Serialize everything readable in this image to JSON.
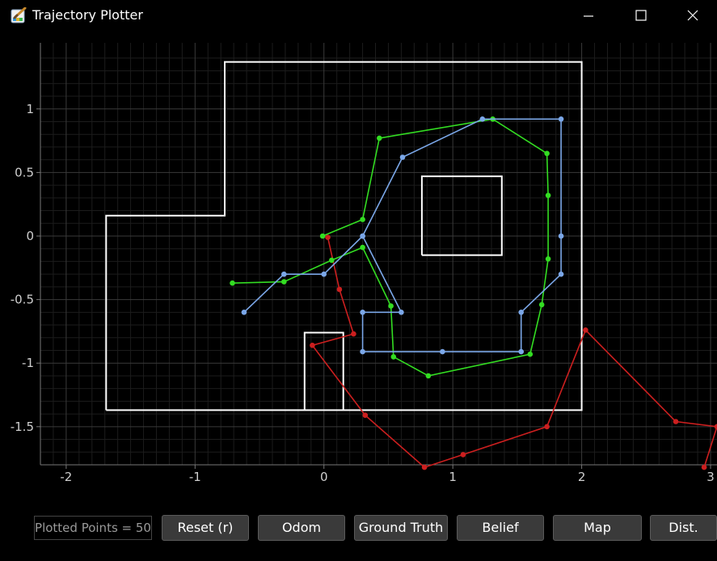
{
  "window": {
    "title": "Trajectory Plotter",
    "app_icon": "paint-brush-icon",
    "controls": [
      "minimize-icon",
      "maximize-icon",
      "close-icon"
    ]
  },
  "colors": {
    "background": "#000000",
    "grid_major": "#3a3a3a",
    "grid_minor": "#1c1c1c",
    "map": "#ffffff",
    "odom": "#cc1f1f",
    "ground_truth": "#33dd22",
    "belief": "#7ba7e8"
  },
  "bottom_bar": {
    "counter": "Plotted Points = 50",
    "buttons": {
      "reset": "Reset (r)",
      "odom": "Odom",
      "ground_truth": "Ground Truth",
      "belief": "Belief",
      "map": "Map",
      "dist": "Dist."
    }
  },
  "chart_data": {
    "type": "line",
    "xlim": [
      -2.2,
      3.05
    ],
    "ylim": [
      -1.8,
      1.52
    ],
    "xticks": [
      "-2",
      "-1",
      "0",
      "1",
      "2",
      "3"
    ],
    "yticks": [
      "1",
      "0.5",
      "0",
      "-0.5",
      "-1",
      "-1.5"
    ],
    "grid": true,
    "map_walls": [
      [
        [
          -1.69,
          -1.37
        ],
        [
          -1.69,
          0.16
        ],
        [
          -0.77,
          0.16
        ],
        [
          -0.77,
          1.37
        ],
        [
          2.0,
          1.37
        ],
        [
          2.0,
          -1.37
        ],
        [
          -1.69,
          -1.37
        ]
      ],
      [
        [
          0.76,
          -0.15
        ],
        [
          1.38,
          -0.15
        ],
        [
          1.38,
          0.47
        ],
        [
          0.76,
          0.47
        ],
        [
          0.76,
          -0.15
        ]
      ],
      [
        [
          -0.15,
          -1.37
        ],
        [
          -0.15,
          -0.76
        ],
        [
          0.15,
          -0.76
        ],
        [
          0.15,
          -1.37
        ]
      ]
    ],
    "series": [
      {
        "key": "odom",
        "points": [
          [
            0.03,
            -0.01
          ],
          [
            0.12,
            -0.42
          ],
          [
            0.23,
            -0.77
          ],
          [
            -0.09,
            -0.86
          ],
          [
            0.32,
            -1.41
          ],
          [
            0.78,
            -1.82
          ],
          [
            1.08,
            -1.72
          ],
          [
            1.73,
            -1.5
          ],
          [
            2.03,
            -0.74
          ],
          [
            2.73,
            -1.46
          ],
          [
            3.05,
            -1.5
          ],
          [
            2.95,
            -1.82
          ]
        ]
      },
      {
        "key": "ground_truth",
        "points": [
          [
            -0.71,
            -0.37
          ],
          [
            -0.31,
            -0.36
          ],
          [
            0.06,
            -0.19
          ],
          [
            0.3,
            -0.09
          ],
          [
            0.52,
            -0.55
          ],
          [
            0.54,
            -0.95
          ],
          [
            0.81,
            -1.1
          ],
          [
            1.6,
            -0.93
          ],
          [
            1.69,
            -0.54
          ],
          [
            1.74,
            -0.18
          ],
          [
            1.74,
            0.32
          ],
          [
            1.73,
            0.65
          ],
          [
            1.31,
            0.92
          ],
          [
            0.43,
            0.77
          ],
          [
            0.3,
            0.13
          ],
          [
            -0.01,
            0.0
          ]
        ]
      },
      {
        "key": "belief",
        "points": [
          [
            -0.62,
            -0.6
          ],
          [
            -0.31,
            -0.3
          ],
          [
            0.0,
            -0.3
          ],
          [
            0.3,
            0.0
          ],
          [
            0.6,
            -0.6
          ],
          [
            0.3,
            -0.6
          ],
          [
            0.3,
            -0.91
          ],
          [
            0.92,
            -0.91
          ],
          [
            1.53,
            -0.91
          ],
          [
            1.53,
            -0.6
          ],
          [
            1.84,
            -0.3
          ],
          [
            1.84,
            0.0
          ],
          [
            1.84,
            0.92
          ],
          [
            1.23,
            0.92
          ],
          [
            0.61,
            0.62
          ],
          [
            0.3,
            0.0
          ]
        ]
      }
    ]
  }
}
